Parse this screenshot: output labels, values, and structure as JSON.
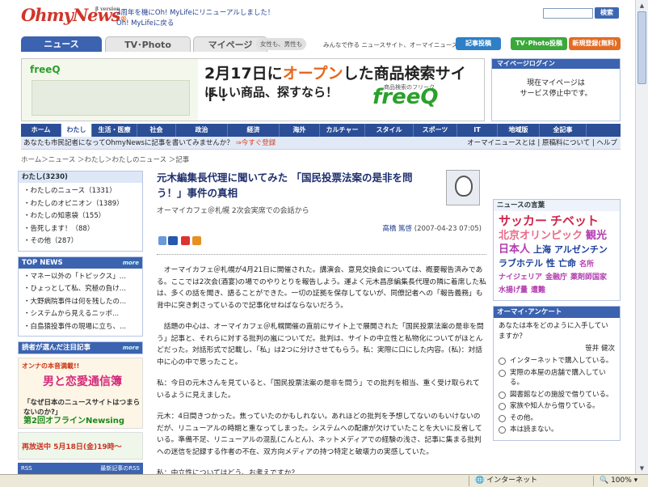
{
  "header": {
    "logo": "OhmyNews",
    "logo_sup": "β version",
    "announce1": "2周年を機にOh! MyLifeにリニューアルしました！",
    "announce2": "Oh! MyLifeに戻る",
    "search_button": "検索",
    "search_placeholder": ""
  },
  "tabs": {
    "news": "ニュース",
    "tv": "TV･Photo",
    "my": "マイページ",
    "tag": "女性も、男性も",
    "tagline": "みんなで作る ニュースサイト、オーマイニュース",
    "post": "記事投稿",
    "tvpost": "TV･Photo投稿",
    "register": "新規登録(無料)"
  },
  "banner": {
    "logo_small": "freeQ",
    "headline_pre": "2月17日",
    "headline_mid": "に",
    "headline_o": "オープン",
    "headline_post": "した商品検索サイト！",
    "sub": "ほしい商品、探すなら！",
    "brand_small": "商品検索のフリーク",
    "brand": "freeQ"
  },
  "login": {
    "title": "マイページログイン",
    "msg1": "現在マイページは",
    "msg2": "サービス停止中です。"
  },
  "nav": [
    "ホーム",
    "わたし",
    "生活・医療",
    "社会",
    "政治",
    "経済",
    "海外",
    "カルチャー",
    "スタイル",
    "スポーツ",
    "IT",
    "地域版",
    "全記事"
  ],
  "nav_active": 1,
  "subbar": {
    "prompt": "あなたも市民記者になってOhmyNewsに記事を書いてみませんか？",
    "register": "⇒今すぐ登録",
    "about": "オーマイニュースとは",
    "principle": "原稿料について",
    "help": "ヘルプ"
  },
  "breadcrumb": "ホーム＞ニュース ＞わたし＞わたしのニュース ＞記事",
  "left": {
    "watashi_title": "わたし",
    "watashi_count": "(3230)",
    "watashi_items": [
      "・わたしのニュース（1331）",
      "・わたしのオピニオン（1389）",
      "・わたしの知恵袋（155）",
      "・告死します！（88）",
      "・その他（287）"
    ],
    "top_title": "TOP NEWS",
    "more": "more",
    "top_items": [
      "・マネー以外の「トピックス」...",
      "・ひょっとして私、究極の負け...",
      "・大野病院事件は何を残したの...",
      "・システムから見えるニッポ...",
      "・白島猿投事件の現場に立ち、..."
    ],
    "popular_title": "読者が選んだ注目記事",
    "ad1_top": "オンナの本音満載!!",
    "ad1_main": "男と恋愛通信簿",
    "ad1_mid": "「なぜ日本のニュースサイトはつまらないのか?」",
    "ad1_mid2": "第2回オフラインNewsing",
    "ad1_foot": "再放送中 5月18日(金)19時～",
    "rss_label": "RSS",
    "rss_latest": "最新記事のRSS"
  },
  "article": {
    "title": "元木編集長代理に聞いてみた 「国民投票法案の是非を問う！」事件の真相",
    "subtitle": "オーマイカフェ＠札幌 2次会実席での会話から",
    "author": "高橋 篤啓",
    "date": "(2007-04-23 07:05)",
    "paragraphs": [
      "オーマイカフェ＠札幌が4月21日に開催された。講演会、意見交換会については、概要報告済みである。ここでは2次会(酒宴)の場でのやりとりを報告しよう。運よく元木昌彦編集長代理の隣に着席した私は、多くの話を聞き、語ることができた。一切の証拠を保存してないが、同僚記者への「報告義務」も背中に突き刺さっているので記事化せねばならないだろう。",
      "話題の中心は、オーマイカフェ＠札幌開催の直前にサイト上で展開された「国民投票法案の是非を問う」記事と、それらに対する批判の嵐についてだ。批判は、サイトの中立性と私物化についてがほとんどだった。対話形式で記載し、「私」は2つに分けさせてもらう。私：実際に口にした内容。(私)：対話中に心の中で思ったこと。",
      "私：今日の元木さんを見ていると、「国民投票法案の是非を問う」での批判を相当、重く受け取られているように見えました。",
      "元木：4日間きつかった。焦っていたのかもしれない。あれほどの批判を予想してないのもいけないのだが、リニューアルの時期と重なってしまった。システムへの配慮が欠けていたことを大いに反省している。準備不足、リニューアルの混乱(こんとん)、ネットメディアでの経験の浅さ、記事に集まる批判への迷信を記録する作者の不在、双方向メディアの持つ特定と破壊力の実感していた。",
      "私：中立性についてはどう、お考えですか？"
    ]
  },
  "right": {
    "words_title": "ニュースの言葉",
    "words": [
      {
        "t": "サッカー",
        "c": "#d0244a",
        "s": 15
      },
      {
        "t": "チベット",
        "c": "#d0244a",
        "s": 15
      },
      {
        "t": "北京オリンピック",
        "c": "#e96b8a",
        "s": 13
      },
      {
        "t": "観光",
        "c": "#b23cb0",
        "s": 13
      },
      {
        "t": "日本人",
        "c": "#b23cb0",
        "s": 13
      },
      {
        "t": "上海",
        "c": "#1b3f9a",
        "s": 11
      },
      {
        "t": "アルゼンチン",
        "c": "#1b3f9a",
        "s": 11
      },
      {
        "t": "ラブホテル",
        "c": "#1b3f9a",
        "s": 11
      },
      {
        "t": "性",
        "c": "#1b3f9a",
        "s": 11
      },
      {
        "t": "亡命",
        "c": "#1b3f9a",
        "s": 11
      },
      {
        "t": "名所",
        "c": "#b23cb0",
        "s": 9
      },
      {
        "t": "ナイジェリア",
        "c": "#b23cb0",
        "s": 9
      },
      {
        "t": "金融庁",
        "c": "#b23cb0",
        "s": 9
      },
      {
        "t": "薬剤師国家",
        "c": "#b23cb0",
        "s": 9
      },
      {
        "t": "水揚げ量",
        "c": "#b23cb0",
        "s": 9
      },
      {
        "t": "遭難",
        "c": "#b23cb0",
        "s": 9
      }
    ],
    "survey_title": "オーマイ･アンケート",
    "survey_q": "あなたは本をどのように入手していますか？",
    "survey_by": "笹井 健次",
    "survey_opts": [
      "インターネットで購入している。",
      "実際の本屋の店舗で購入している。",
      "図書館などの施設で借りている。",
      "家族や知人から借りている。",
      "その他。",
      "本は読まない。"
    ]
  },
  "statusbar": {
    "zone": "インターネット",
    "zoom": "100%"
  }
}
